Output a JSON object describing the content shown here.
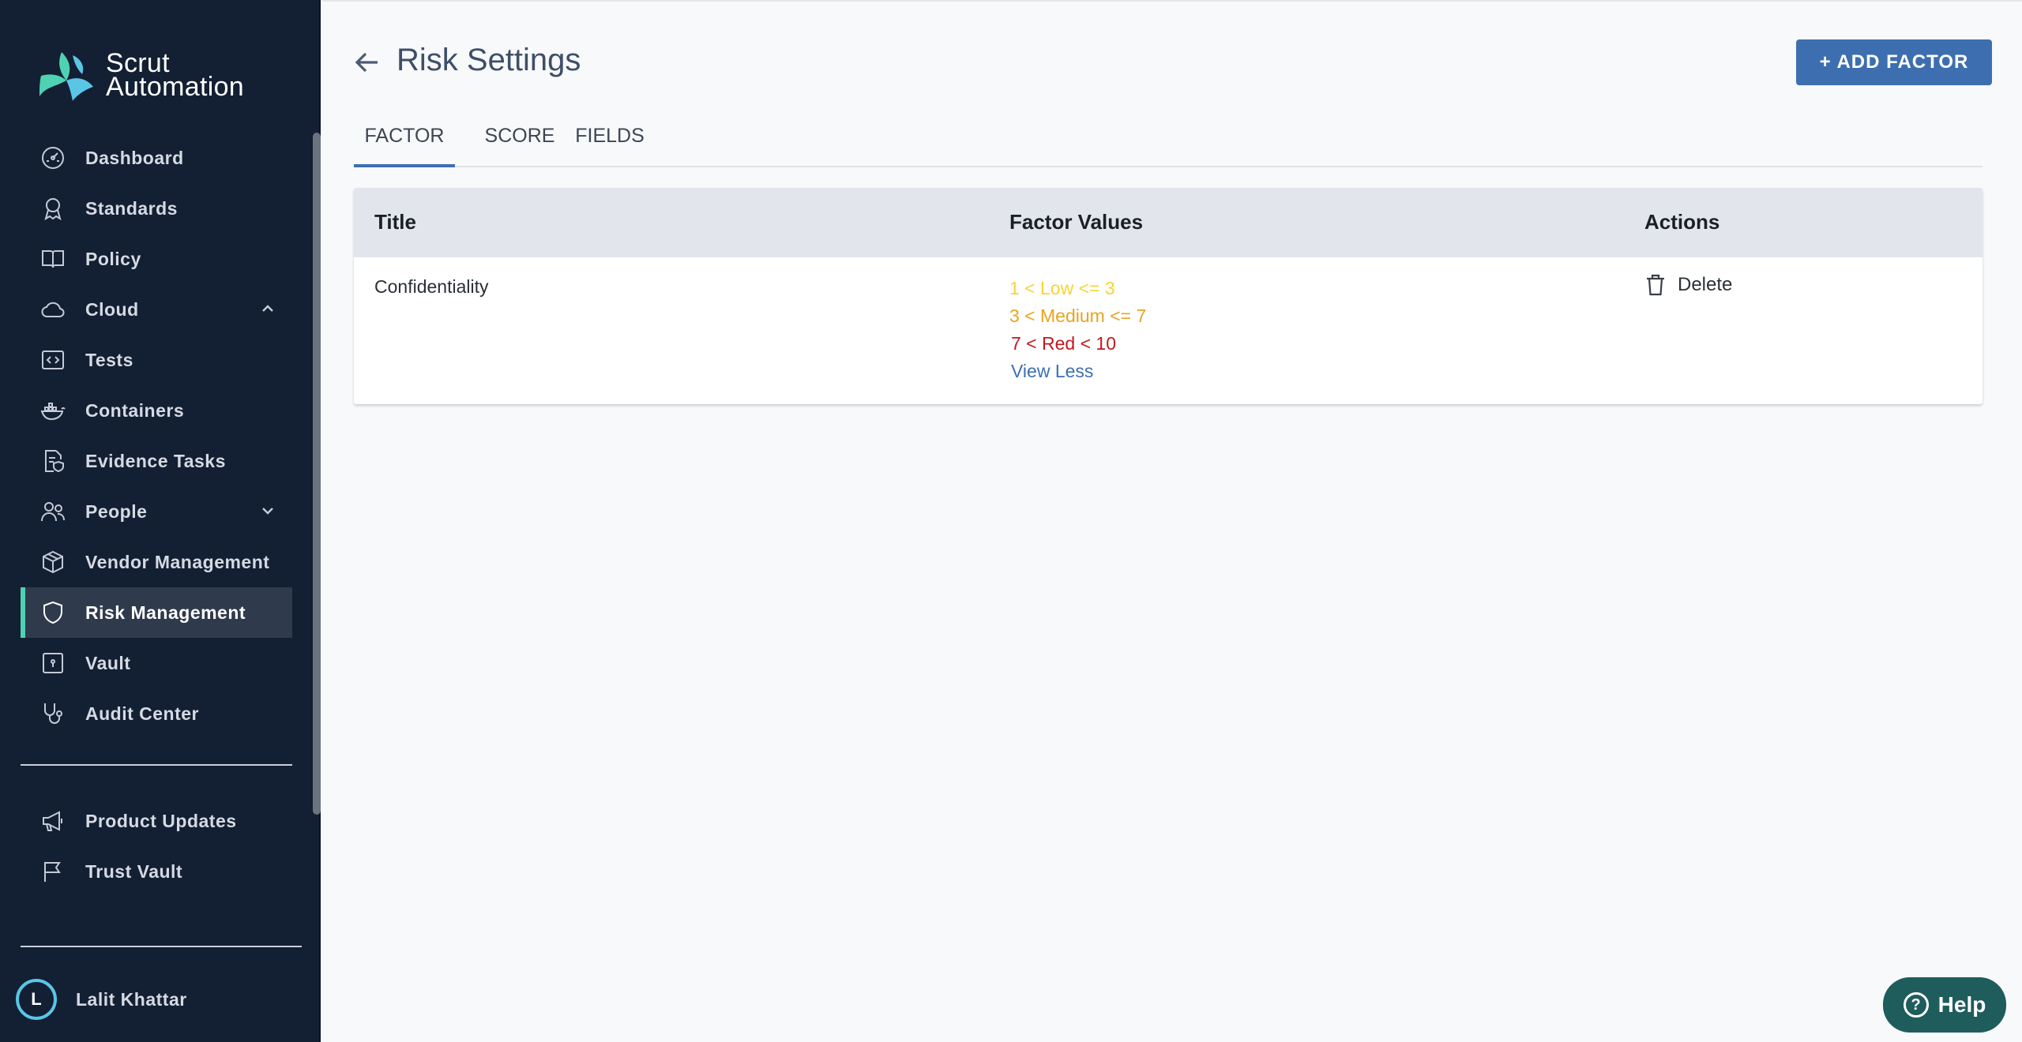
{
  "brand": {
    "line1": "Scrut",
    "line2": "Automation",
    "logo_colors": [
      "#4fd1b4",
      "#59c6e6"
    ]
  },
  "sidebar": {
    "items": [
      {
        "label": "Dashboard",
        "icon": "dashboard-gauge-icon"
      },
      {
        "label": "Standards",
        "icon": "award-ribbon-icon"
      },
      {
        "label": "Policy",
        "icon": "open-book-icon"
      },
      {
        "label": "Cloud",
        "icon": "cloud-icon",
        "expanded": true
      },
      {
        "label": "Tests",
        "icon": "code-window-icon"
      },
      {
        "label": "Containers",
        "icon": "docker-whale-icon"
      },
      {
        "label": "Evidence Tasks",
        "icon": "document-shield-icon"
      },
      {
        "label": "People",
        "icon": "people-icon",
        "expanded": false
      },
      {
        "label": "Vendor Management",
        "icon": "package-box-icon"
      },
      {
        "label": "Risk Management",
        "icon": "shield-icon",
        "active": true
      },
      {
        "label": "Vault",
        "icon": "vault-lock-icon"
      },
      {
        "label": "Audit Center",
        "icon": "stethoscope-icon"
      }
    ],
    "secondary": [
      {
        "label": "Product Updates",
        "icon": "megaphone-icon"
      },
      {
        "label": "Trust Vault",
        "icon": "flag-icon"
      }
    ],
    "user": {
      "initial": "L",
      "name": "Lalit Khattar"
    }
  },
  "header": {
    "title": "Risk Settings",
    "add_button": "+ ADD FACTOR"
  },
  "tabs": [
    {
      "label": "FACTOR",
      "active": true
    },
    {
      "label": "SCORE"
    },
    {
      "label": "FIELDS"
    }
  ],
  "table": {
    "columns": [
      "Title",
      "Factor Values",
      "Actions"
    ],
    "rows": [
      {
        "title": "Confidentiality",
        "values": [
          "1 < Low <= 3",
          "3 < Medium <= 7",
          "7 < Red < 10"
        ],
        "toggle": "View Less",
        "action": "Delete"
      }
    ]
  },
  "help": {
    "label": "Help"
  },
  "colors": {
    "accent": "#3d6fb0",
    "sidebar_bg": "#131f33",
    "low": "#f6d533",
    "medium": "#e8a422",
    "red": "#c0191f",
    "help_bg": "#1f5c5c"
  }
}
